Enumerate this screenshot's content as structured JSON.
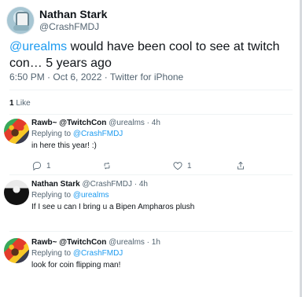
{
  "tweet": {
    "author": "Nathan Stark",
    "handle": "@CrashFMDJ",
    "mention": "@urealms",
    "text": " would have been cool to see at twitch con… 5 years ago",
    "timestamp": "6:50 PM · Oct 6, 2022 · Twitter for iPhone",
    "likes_count": "1",
    "likes_label": "Like"
  },
  "replies": [
    {
      "display_name": "Rawb~ @TwitchCon",
      "meta": "@urealms · 4h",
      "replying_to": "Replying to",
      "replying_handle": "@CrashFMDJ",
      "text": "in here this year! :)",
      "reply_count": "1",
      "retweet_count": "",
      "like_count": "1"
    },
    {
      "display_name": "Nathan Stark",
      "meta": "@CrashFMDJ · 4h",
      "replying_to": "Replying to",
      "replying_handle": "@urealms",
      "text": "If I see u can I bring u a Bipen Ampharos plush"
    },
    {
      "display_name": "Rawb~ @TwitchCon",
      "meta": "@urealms · 1h",
      "replying_to": "Replying to",
      "replying_handle": "@CrashFMDJ",
      "text": "look for coin flipping man!"
    }
  ],
  "colors": {
    "link": "#1d9bf0",
    "secondary_text": "#536471",
    "divider": "#eff3f4"
  }
}
